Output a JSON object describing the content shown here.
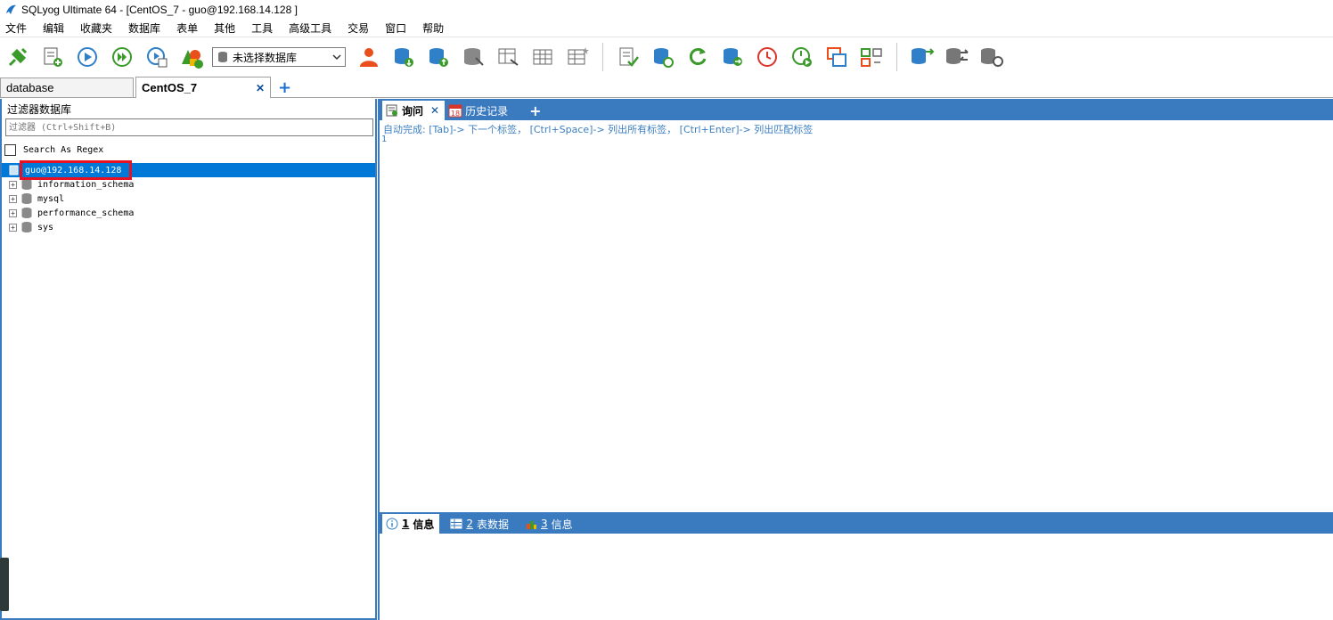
{
  "window": {
    "title": "SQLyog Ultimate 64 - [CentOS_7 - guo@192.168.14.128 ]"
  },
  "menu": [
    "文件",
    "编辑",
    "收藏夹",
    "数据库",
    "表单",
    "其他",
    "工具",
    "高级工具",
    "交易",
    "窗口",
    "帮助"
  ],
  "toolbar": {
    "database_select": "未选择数据库"
  },
  "connection_tabs": [
    {
      "label": "database"
    },
    {
      "label": "CentOS_7",
      "close": "✕"
    }
  ],
  "add_tab": "+",
  "filter_panel": {
    "title": "过滤器数据库",
    "placeholder": "过滤器 (Ctrl+Shift+B)",
    "regex_label": "Search As Regex"
  },
  "tree": {
    "root": "guo@192.168.14.128",
    "databases": [
      "information_schema",
      "mysql",
      "performance_schema",
      "sys"
    ]
  },
  "query_tabs": {
    "query": "询问",
    "history": "历史记录",
    "close": "✕",
    "add": "+",
    "calendar_day": "18"
  },
  "editor": {
    "hint": "自动完成: [Tab]-> 下一个标签， [Ctrl+Space]-> 列出所有标签， [Ctrl+Enter]-> 列出匹配标签",
    "line": "1"
  },
  "result_tabs": [
    {
      "num": "1",
      "label": "信息"
    },
    {
      "num": "2",
      "label": "表数据"
    },
    {
      "num": "3",
      "label": "信息"
    }
  ],
  "colors": {
    "accent": "#3a7abf",
    "selection": "#0078d7",
    "highlight": "#e81123"
  }
}
